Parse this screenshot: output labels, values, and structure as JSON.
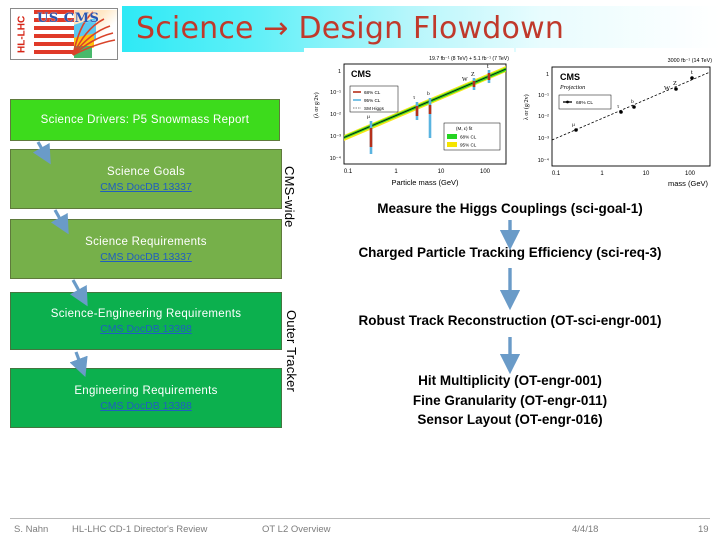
{
  "slide": {
    "title": "Science → Design Flowdown"
  },
  "logo": {
    "vertical_text": "HL-LHC",
    "brand_text": "US CMS"
  },
  "left_flow": {
    "boxes": [
      {
        "title": "Science Drivers: P5 Snowmass Report",
        "link": "",
        "color": "#3ddb1c"
      },
      {
        "title": "Science Goals",
        "link": "CMS DocDB 13337",
        "color": "#76b04a"
      },
      {
        "title": "Science  Requirements",
        "link": "CMS DocDB 13337",
        "color": "#76b04a"
      },
      {
        "title": "Science-Engineering  Requirements",
        "link": "CMS DocDB 13388",
        "color": "#0cb04e"
      },
      {
        "title": "Engineering  Requirements",
        "link": "CMS DocDB 13388",
        "color": "#0cb04e"
      }
    ]
  },
  "brackets": {
    "cms_wide": "CMS-wide",
    "outer_tracker": "Outer Tracker"
  },
  "right_flow": {
    "science_goal": "Measure the Higgs Couplings (sci-goal-1)",
    "science_requirement": "Charged Particle Tracking Efficiency (sci-req-3)",
    "science_engineering": "Robust Track Reconstruction (OT-sci-engr-001)",
    "engineering_list": [
      "Hit Multiplicity (OT-engr-001)",
      "Fine Granularity (OT-engr-011)",
      "Sensor Layout (OT-engr-016)"
    ]
  },
  "plots": {
    "left": {
      "experiment": "CMS",
      "header": "19.7 fb⁻¹ (8 TeV) + 5.1 fb⁻¹ (7 TeV)",
      "ylabel": "(λᶠ or √ɣ)",
      "xlabel": "Particle mass (GeV)",
      "legend": [
        "68% CL",
        "95% CL",
        "SM Higgs"
      ],
      "legend2_title": "(M, ε) fit",
      "legend2": [
        "68% CL",
        "95% CL"
      ],
      "particles": [
        "μ",
        "τ",
        "b",
        "W",
        "Z",
        "t"
      ],
      "xticks": [
        "0.1",
        "1",
        "10",
        "100"
      ],
      "yticks": [
        "1",
        "10⁻¹",
        "10⁻²",
        "10⁻³",
        "10⁻⁴"
      ]
    },
    "right": {
      "experiment": "CMS",
      "subtitle": "Projection",
      "header": "3000 fb⁻¹ (14 TeV)",
      "ylabel": "λᶠ or (ɣ/2v)¹ᶠ²",
      "xlabel": "mass (GeV)",
      "legend": [
        "68% CL"
      ],
      "particles": [
        "μ",
        "τ",
        "b",
        "W",
        "Z",
        "t"
      ],
      "xticks": [
        "0.1",
        "1",
        "10",
        "100"
      ],
      "yticks": [
        "1",
        "10⁻¹",
        "10⁻²",
        "10⁻³",
        "10⁻⁴"
      ]
    }
  },
  "footer": {
    "author": "S. Nahn",
    "review": "HL-LHC CD-1 Director's Review",
    "subject": "OT L2 Overview",
    "date": "4/4/18",
    "page": "19"
  }
}
